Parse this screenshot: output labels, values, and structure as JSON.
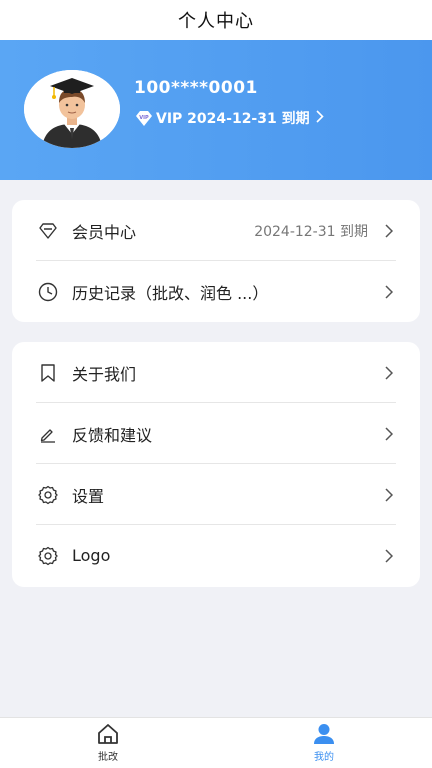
{
  "header": {
    "title": "个人中心"
  },
  "profile": {
    "username": "100****0001",
    "vip_text": "VIP 2024-12-31 到期",
    "vip_badge": "VIP"
  },
  "membership_card": {
    "items": [
      {
        "label": "会员中心",
        "value": "2024-12-31 到期",
        "icon": "diamond-icon"
      },
      {
        "label": "历史记录（批改、润色 ...）",
        "icon": "clock-icon"
      }
    ]
  },
  "menu_card": {
    "items": [
      {
        "label": "关于我们",
        "icon": "bookmark-icon"
      },
      {
        "label": "反馈和建议",
        "icon": "pencil-icon"
      },
      {
        "label": "设置",
        "icon": "gear-icon"
      },
      {
        "label": "Logo",
        "icon": "gear-icon"
      }
    ]
  },
  "tabbar": {
    "tabs": [
      {
        "label": "批改",
        "icon": "home-icon",
        "active": false
      },
      {
        "label": "我的",
        "icon": "user-icon",
        "active": true
      }
    ]
  },
  "colors": {
    "accent": "#4b97ee",
    "active_tab": "#3b8ff0"
  }
}
